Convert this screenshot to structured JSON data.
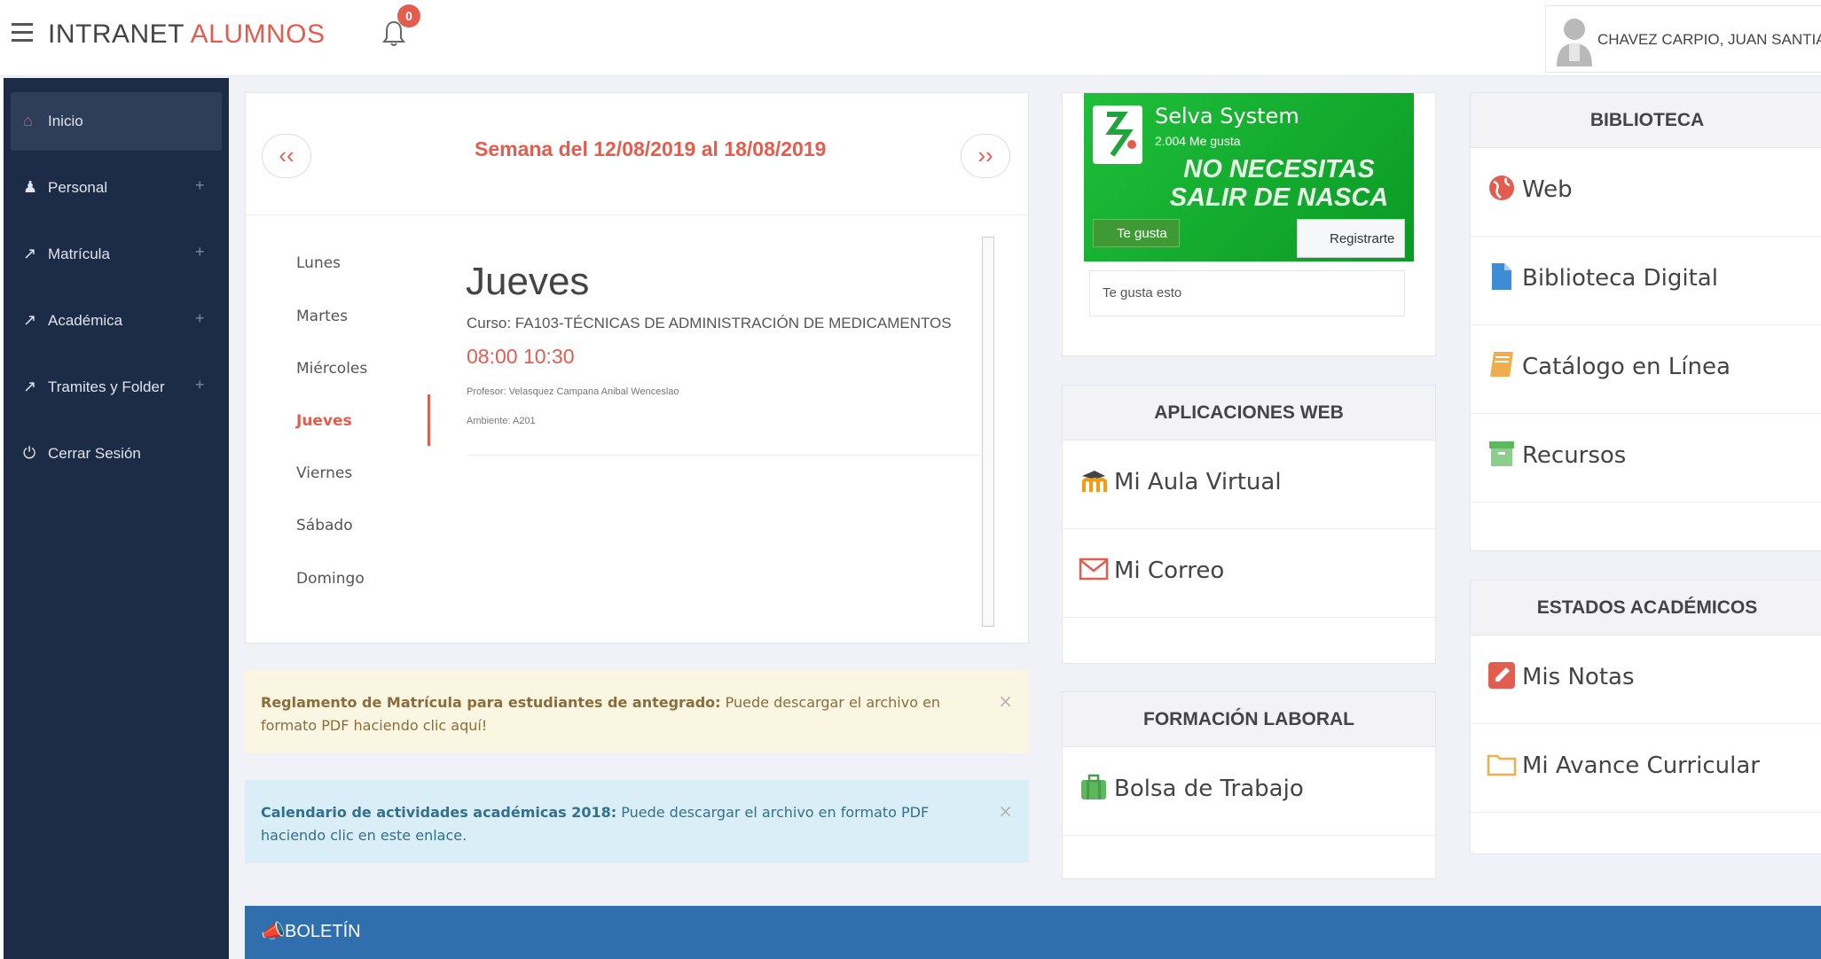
{
  "header": {
    "brand_part1": "INTRANET",
    "brand_part2": "ALUMNOS",
    "notifications_count": "0",
    "user_name": "CHAVEZ CARPIO, JUAN SANTIAGO"
  },
  "sidebar": {
    "items": [
      {
        "label": "Inicio",
        "icon": "home-icon",
        "active": true,
        "expandable": false
      },
      {
        "label": "Personal",
        "icon": "user-icon",
        "expandable": true
      },
      {
        "label": "Matrícula",
        "icon": "external-link-icon",
        "expandable": true
      },
      {
        "label": "Académica",
        "icon": "external-link-icon",
        "expandable": true
      },
      {
        "label": "Tramites y Folder",
        "icon": "external-link-icon",
        "expandable": true
      },
      {
        "label": "Cerrar Sesión",
        "icon": "power-icon",
        "expandable": false
      }
    ],
    "plus_label": "+"
  },
  "schedule": {
    "prev_label": "‹‹",
    "next_label": "››",
    "week_title": "Semana del 12/08/2019 al 18/08/2019",
    "days": [
      "Lunes",
      "Martes",
      "Miércoles",
      "Jueves",
      "Viernes",
      "Sábado",
      "Domingo"
    ],
    "active_day": "Jueves",
    "detail": {
      "day": "Jueves",
      "course": "Curso: FA103-TÉCNICAS DE ADMINISTRACIÓN DE MEDICAMENTOS",
      "time": "08:00 10:30",
      "professor": "Profesor: Velasquez Campana Anibal Wenceslao",
      "room": "Ambiente: A201"
    }
  },
  "alerts": [
    {
      "title": "Reglamento de Matrícula para estudiantes de antegrado:",
      "text": " Puede descargar el archivo en formato PDF haciendo clic aquí!",
      "close": "×"
    },
    {
      "title": "Calendario de actividades académicas 2018:",
      "text": " Puede descargar el archivo en formato PDF haciendo clic en este enlace.",
      "close": "×"
    }
  ],
  "boletin": {
    "label": "BOLETÍN"
  },
  "facebook": {
    "page_name": "Selva System",
    "likes": "2.004 Me gusta",
    "slogan": "NO NECESITAS SALIR DE NASCA",
    "like_button": "Te gusta",
    "register_button": "Registrarte",
    "footer": "Te gusta esto"
  },
  "apps": {
    "title": "APLICACIONES WEB",
    "items": [
      {
        "label": "Mi Aula Virtual",
        "icon": "moodle-icon"
      },
      {
        "label": "Mi Correo",
        "icon": "mail-icon"
      }
    ]
  },
  "laboral": {
    "title": "FORMACIÓN LABORAL",
    "items": [
      {
        "label": "Bolsa de Trabajo",
        "icon": "briefcase-icon"
      }
    ]
  },
  "biblioteca": {
    "title": "BIBLIOTECA",
    "items": [
      {
        "label": "Web",
        "icon": "globe-icon"
      },
      {
        "label": "Biblioteca Digital",
        "icon": "document-icon"
      },
      {
        "label": "Catálogo en Línea",
        "icon": "book-icon"
      },
      {
        "label": "Recursos",
        "icon": "archive-icon"
      }
    ]
  },
  "estados": {
    "title": "ESTADOS ACADÉMICOS",
    "items": [
      {
        "label": "Mis Notas",
        "icon": "pencil-icon"
      },
      {
        "label": "Mi Avance Curricular",
        "icon": "folder-icon"
      }
    ]
  },
  "colors": {
    "accent": "#e35d4f",
    "sidebar_bg": "#1c2b46",
    "boletin_bg": "#2f6fad",
    "fb_green": "#1fbf3a"
  }
}
